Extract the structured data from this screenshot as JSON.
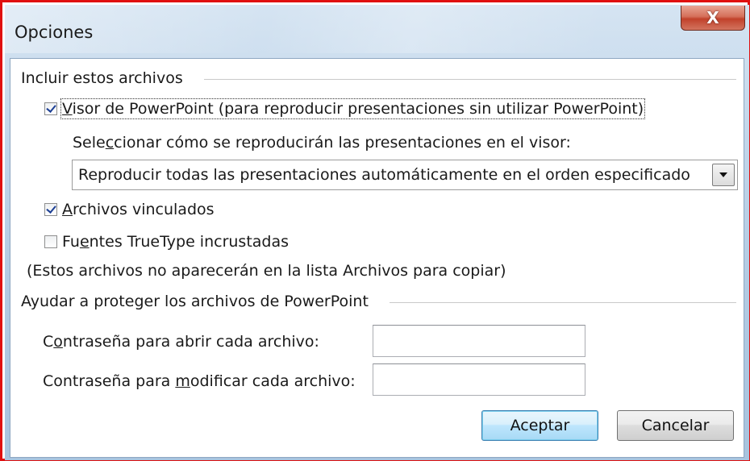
{
  "window": {
    "title": "Opciones",
    "close_glyph": "X"
  },
  "include_group": {
    "label": "Incluir estos archivos",
    "viewer_checkbox": {
      "checked": true,
      "label_u": "V",
      "label_rest": "isor de PowerPoint (para reproducir presentaciones sin utilizar PowerPoint)"
    },
    "select_prompt": {
      "before": "Sele",
      "underlined": "c",
      "after": "cionar cómo se reproducirán las presentaciones en el visor:"
    },
    "playback_select": {
      "value": "Reproducir todas las presentaciones automáticamente en el orden especificado"
    },
    "linked_checkbox": {
      "checked": true,
      "label_u": "A",
      "label_rest": "rchivos vinculados"
    },
    "fonts_checkbox": {
      "checked": false,
      "label_before": "Fu",
      "label_u": "e",
      "label_after": "ntes TrueType incrustadas"
    },
    "note": "(Estos archivos no aparecerán en la lista Archivos para copiar)"
  },
  "protect_group": {
    "label": "Ayudar a proteger los archivos de PowerPoint",
    "open_password": {
      "label_before": "C",
      "label_u": "o",
      "label_after": "ntraseña para abrir cada archivo:",
      "value": ""
    },
    "modify_password": {
      "label_before": "Contraseña para ",
      "label_u": "m",
      "label_after": "odificar cada archivo:",
      "value": ""
    }
  },
  "buttons": {
    "ok": "Aceptar",
    "cancel": "Cancelar"
  }
}
